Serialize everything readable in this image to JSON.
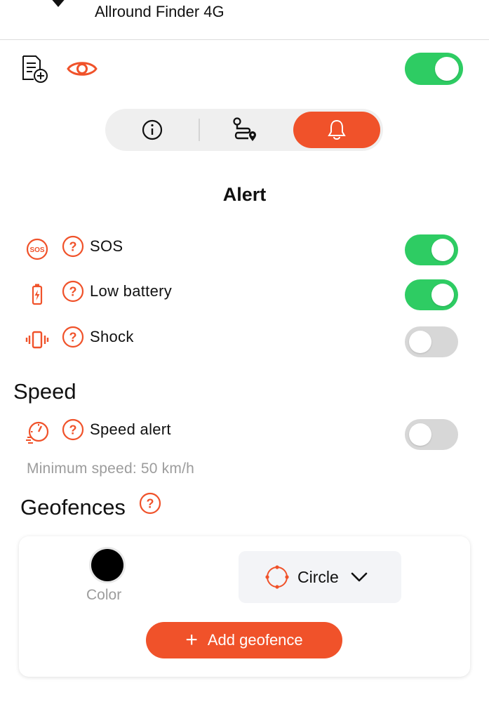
{
  "header": {
    "title": "Allround Finder 4G"
  },
  "toolbar": {
    "visibility_toggle_on": true
  },
  "tabs": [
    {
      "name": "info",
      "icon": "info-icon",
      "active": false
    },
    {
      "name": "route",
      "icon": "route-icon",
      "active": false
    },
    {
      "name": "alert",
      "icon": "bell-icon",
      "active": true
    }
  ],
  "alert": {
    "title": "Alert",
    "items": [
      {
        "label": "SOS",
        "icon": "sos-icon",
        "enabled": true
      },
      {
        "label": "Low battery",
        "icon": "battery-icon",
        "enabled": true
      },
      {
        "label": "Shock",
        "icon": "vibration-icon",
        "enabled": false
      }
    ]
  },
  "speed": {
    "title": "Speed",
    "alert_label": "Speed alert",
    "enabled": false,
    "minimum_text": "Minimum speed: 50 km/h"
  },
  "geofences": {
    "title": "Geofences",
    "color_label": "Color",
    "color_value": "#000000",
    "shape_value": "Circle",
    "add_label": "Add geofence"
  },
  "colors": {
    "accent": "#f0522a",
    "toggle_on": "#2ecc63",
    "toggle_off": "#d7d7d7"
  }
}
